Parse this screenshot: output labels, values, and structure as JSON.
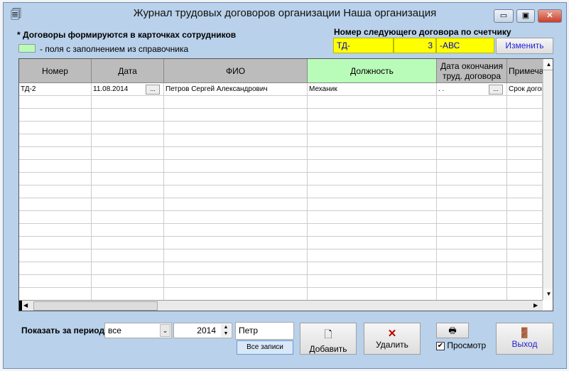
{
  "window": {
    "title": "Журнал трудовых договоров организации  Наша организация"
  },
  "notes": {
    "contracts_note": "* Договоры формируются в карточках сотрудников",
    "legend_text": "- поля с заполнением из справочника",
    "legend_color": "#b9fbb9"
  },
  "counter": {
    "label": "Номер следующего договора по счетчику",
    "prefix": "ТД-",
    "number": "3",
    "suffix": "-АВС",
    "change_button": "Изменить"
  },
  "table": {
    "columns": [
      "Номер",
      "Дата",
      "ФИО",
      "Должность",
      "Дата окончания труд. договора",
      "Примечание"
    ],
    "rows": [
      {
        "number": "ТД-2",
        "date": "11.08.2014",
        "dots": "...",
        "fio": "Петров Сергей Александрович",
        "position": "Механик",
        "end_date": " .  .",
        "dots2": "...",
        "note": "Срок договора"
      }
    ]
  },
  "footer": {
    "period_label": "Показать за период:",
    "period_value": "все",
    "year": "2014",
    "search": "Петр",
    "all_records": "Все записи",
    "add": "Добавить",
    "delete": "Удалить",
    "preview": "Просмотр",
    "preview_checked": true,
    "exit": "Выход"
  }
}
